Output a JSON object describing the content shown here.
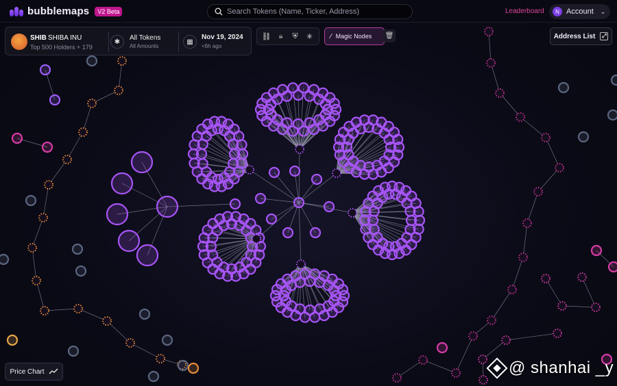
{
  "app": {
    "name": "bubblemaps",
    "version_badge": "V2 Beta"
  },
  "search": {
    "placeholder": "Search Tokens (Name, Ticker, Address)"
  },
  "header": {
    "leaderboard": "Leaderboard",
    "account": "Account",
    "account_initial": "N"
  },
  "token": {
    "ticker": "SHIB",
    "name": "SHIBA INU",
    "holders": "Top 500 Holders + 179"
  },
  "filter": {
    "title": "All Tokens",
    "subtitle": "All Amounts"
  },
  "snapshot": {
    "date": "Nov 19, 2024",
    "age": "<6h ago"
  },
  "toolbar": {
    "tools": [
      "link-icon",
      "lock-icon",
      "shield-icon",
      "cluster-icon"
    ],
    "magic_nodes": "Magic Nodes"
  },
  "address_list": {
    "label": "Address List"
  },
  "price_chart": {
    "label": "Price Chart"
  },
  "watermark": {
    "text": "@ shanhai _y"
  },
  "colors": {
    "background": "#0b0b17",
    "node_purple": "#a855f7",
    "node_magenta": "#d63ca5",
    "node_orange": "#e88a3a",
    "node_grey": "#5b6680",
    "accent": "#c0168e"
  }
}
